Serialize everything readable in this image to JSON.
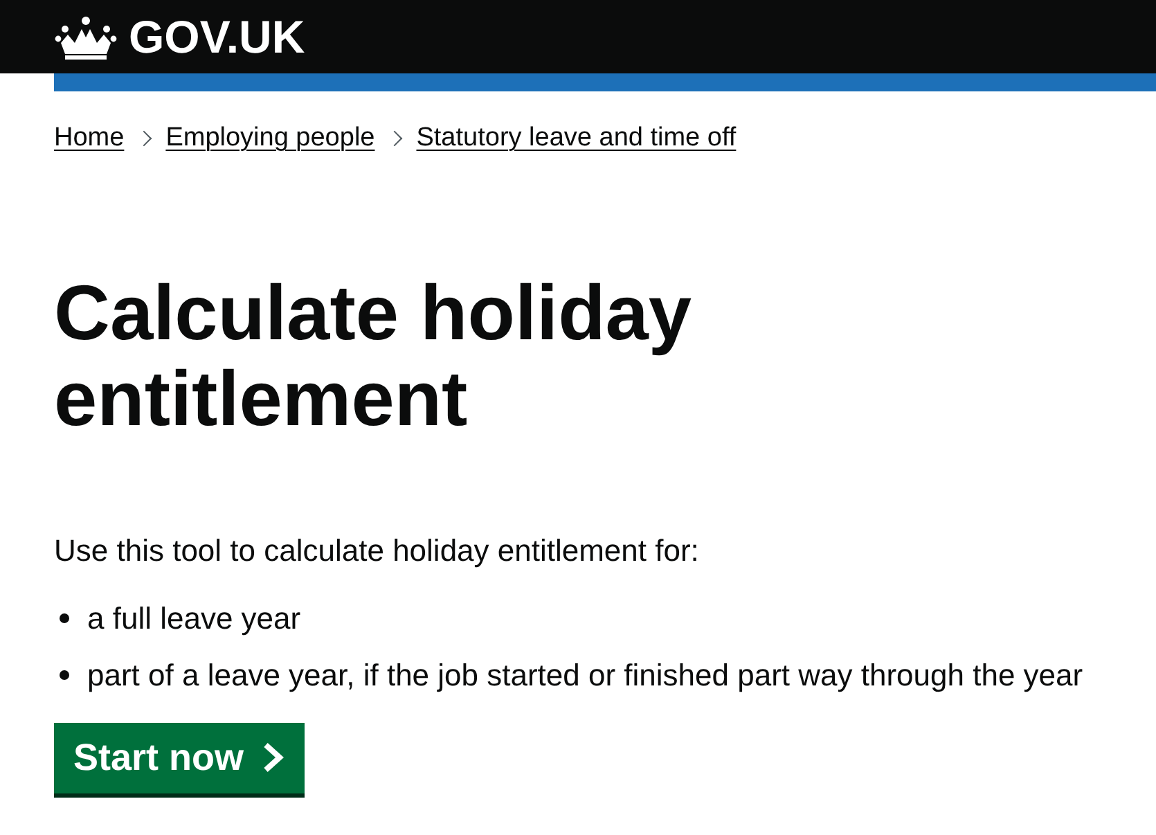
{
  "header": {
    "logo_text": "GOV.UK"
  },
  "breadcrumbs": [
    {
      "label": "Home"
    },
    {
      "label": "Employing people"
    },
    {
      "label": "Statutory leave and time off"
    }
  ],
  "title": "Calculate holiday entitlement",
  "intro": "Use this tool to calculate holiday entitlement for:",
  "list_items": [
    "a full leave year",
    "part of a leave year, if the job started or finished part way through the year"
  ],
  "start_button": {
    "label": "Start now"
  }
}
